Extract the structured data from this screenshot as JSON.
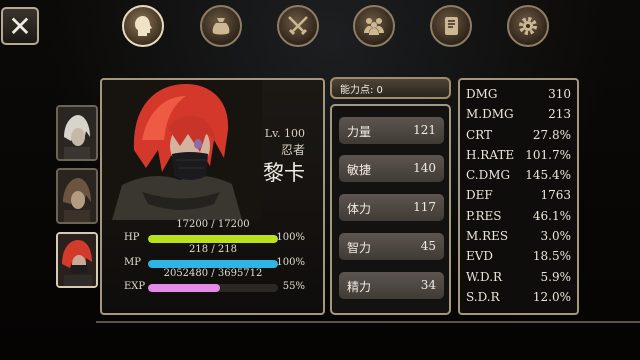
{
  "tabs": [
    {
      "name": "tab-character",
      "icon": "head-icon",
      "active": true
    },
    {
      "name": "tab-inventory",
      "icon": "bag-icon",
      "active": false
    },
    {
      "name": "tab-skills",
      "icon": "crossed-swords-icon",
      "active": false
    },
    {
      "name": "tab-party",
      "icon": "people-icon",
      "active": false
    },
    {
      "name": "tab-quest",
      "icon": "scroll-icon",
      "active": false
    },
    {
      "name": "tab-settings",
      "icon": "gear-icon",
      "active": false
    }
  ],
  "character": {
    "level": "Lv. 100",
    "job": "忍者",
    "name": "黎卡",
    "hp": {
      "label": "HP",
      "value": "17200 / 17200",
      "percent": "100%",
      "fill": 1.0
    },
    "mp": {
      "label": "MP",
      "value": "218 / 218",
      "percent": "100%",
      "fill": 1.0
    },
    "exp": {
      "label": "EXP",
      "value": "2052480 / 3695712",
      "percent": "55%",
      "fill": 0.555
    }
  },
  "ability_points": "能力点: 0",
  "base_stats": [
    {
      "label": "力量",
      "value": "121"
    },
    {
      "label": "敏捷",
      "value": "140"
    },
    {
      "label": "体力",
      "value": "117"
    },
    {
      "label": "智力",
      "value": "45"
    },
    {
      "label": "精力",
      "value": "34"
    }
  ],
  "detail_stats": [
    {
      "label": "DMG",
      "value": "310"
    },
    {
      "label": "M.DMG",
      "value": "213"
    },
    {
      "label": "CRT",
      "value": "27.8%"
    },
    {
      "label": "H.RATE",
      "value": "101.7%"
    },
    {
      "label": "C.DMG",
      "value": "145.4%"
    },
    {
      "label": "DEF",
      "value": "1763"
    },
    {
      "label": "P.RES",
      "value": "46.1%"
    },
    {
      "label": "M.RES",
      "value": "3.0%"
    },
    {
      "label": "EVD",
      "value": "18.5%"
    },
    {
      "label": "W.D.R",
      "value": "5.9%"
    },
    {
      "label": "S.D.R",
      "value": "12.0%"
    }
  ],
  "colors": {
    "hp": "#b9e21c",
    "mp": "#2fb4e6",
    "exp": "#e58ae6",
    "frame": "#a4977f"
  }
}
